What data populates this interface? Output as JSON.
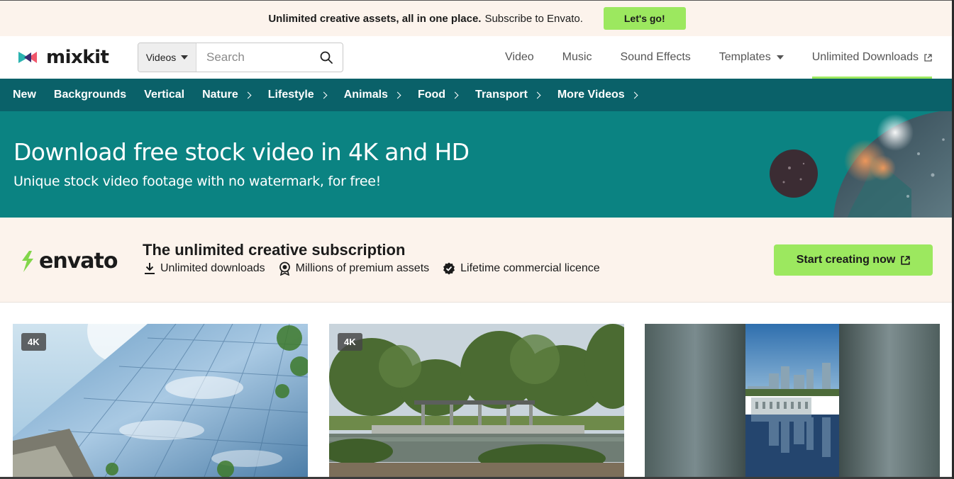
{
  "promo": {
    "bold_text": "Unlimited creative assets, all in one place.",
    "text": "Subscribe to Envato.",
    "cta_label": "Let's go!"
  },
  "header": {
    "logo_text": "mixkit",
    "search": {
      "scope": "Videos",
      "placeholder": "Search"
    },
    "nav": [
      {
        "label": "Video"
      },
      {
        "label": "Music"
      },
      {
        "label": "Sound Effects"
      },
      {
        "label": "Templates"
      },
      {
        "label": "Unlimited Downloads"
      }
    ]
  },
  "categories": [
    {
      "label": "New"
    },
    {
      "label": "Backgrounds"
    },
    {
      "label": "Vertical"
    },
    {
      "label": "Nature"
    },
    {
      "label": "Lifestyle"
    },
    {
      "label": "Animals"
    },
    {
      "label": "Food"
    },
    {
      "label": "Transport"
    },
    {
      "label": "More Videos"
    }
  ],
  "hero": {
    "title": "Download free stock video in 4K and HD",
    "subtitle": "Unique stock video footage with no watermark, for free!"
  },
  "envato": {
    "logo_text": "envato",
    "title": "The unlimited creative subscription",
    "features": [
      {
        "label": "Unlimited downloads",
        "icon": "download-icon"
      },
      {
        "label": "Millions of premium assets",
        "icon": "award-badge-icon"
      },
      {
        "label": "Lifetime commercial licence",
        "icon": "verified-check-icon"
      }
    ],
    "cta_label": "Start creating now"
  },
  "videos": [
    {
      "badge": "4K",
      "subject": "glass skyscraper"
    },
    {
      "badge": "4K",
      "subject": "park pond with pavilion"
    },
    {
      "badge": "",
      "subject": "city skyline reflected in water"
    }
  ],
  "colors": {
    "accent_green": "#9ce85f",
    "category_bar": "#0a6169",
    "hero_bg": "#0b8382",
    "promo_bg": "#fcf3ec"
  }
}
